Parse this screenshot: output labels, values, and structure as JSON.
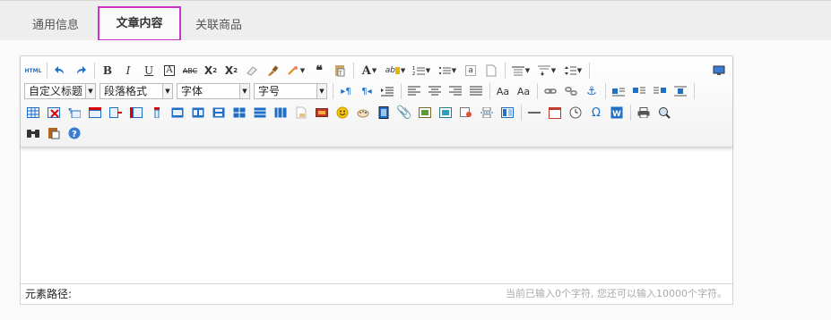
{
  "tabs": [
    {
      "label": "通用信息"
    },
    {
      "label": "文章内容"
    },
    {
      "label": "关联商品"
    }
  ],
  "toolbar": {
    "html_label": "HTML",
    "custom_title_select": "自定义标题",
    "paragraph_select": "段落格式",
    "font_family_select": "字体",
    "font_size_select": "字号"
  },
  "status": {
    "path_label": "元素路径:",
    "word_count": "当前已输入0个字符, 您还可以输入10000个字符。"
  },
  "colors": {
    "active_tab_border": "#cc33cc",
    "icon_blue": "#1f6fc4"
  }
}
